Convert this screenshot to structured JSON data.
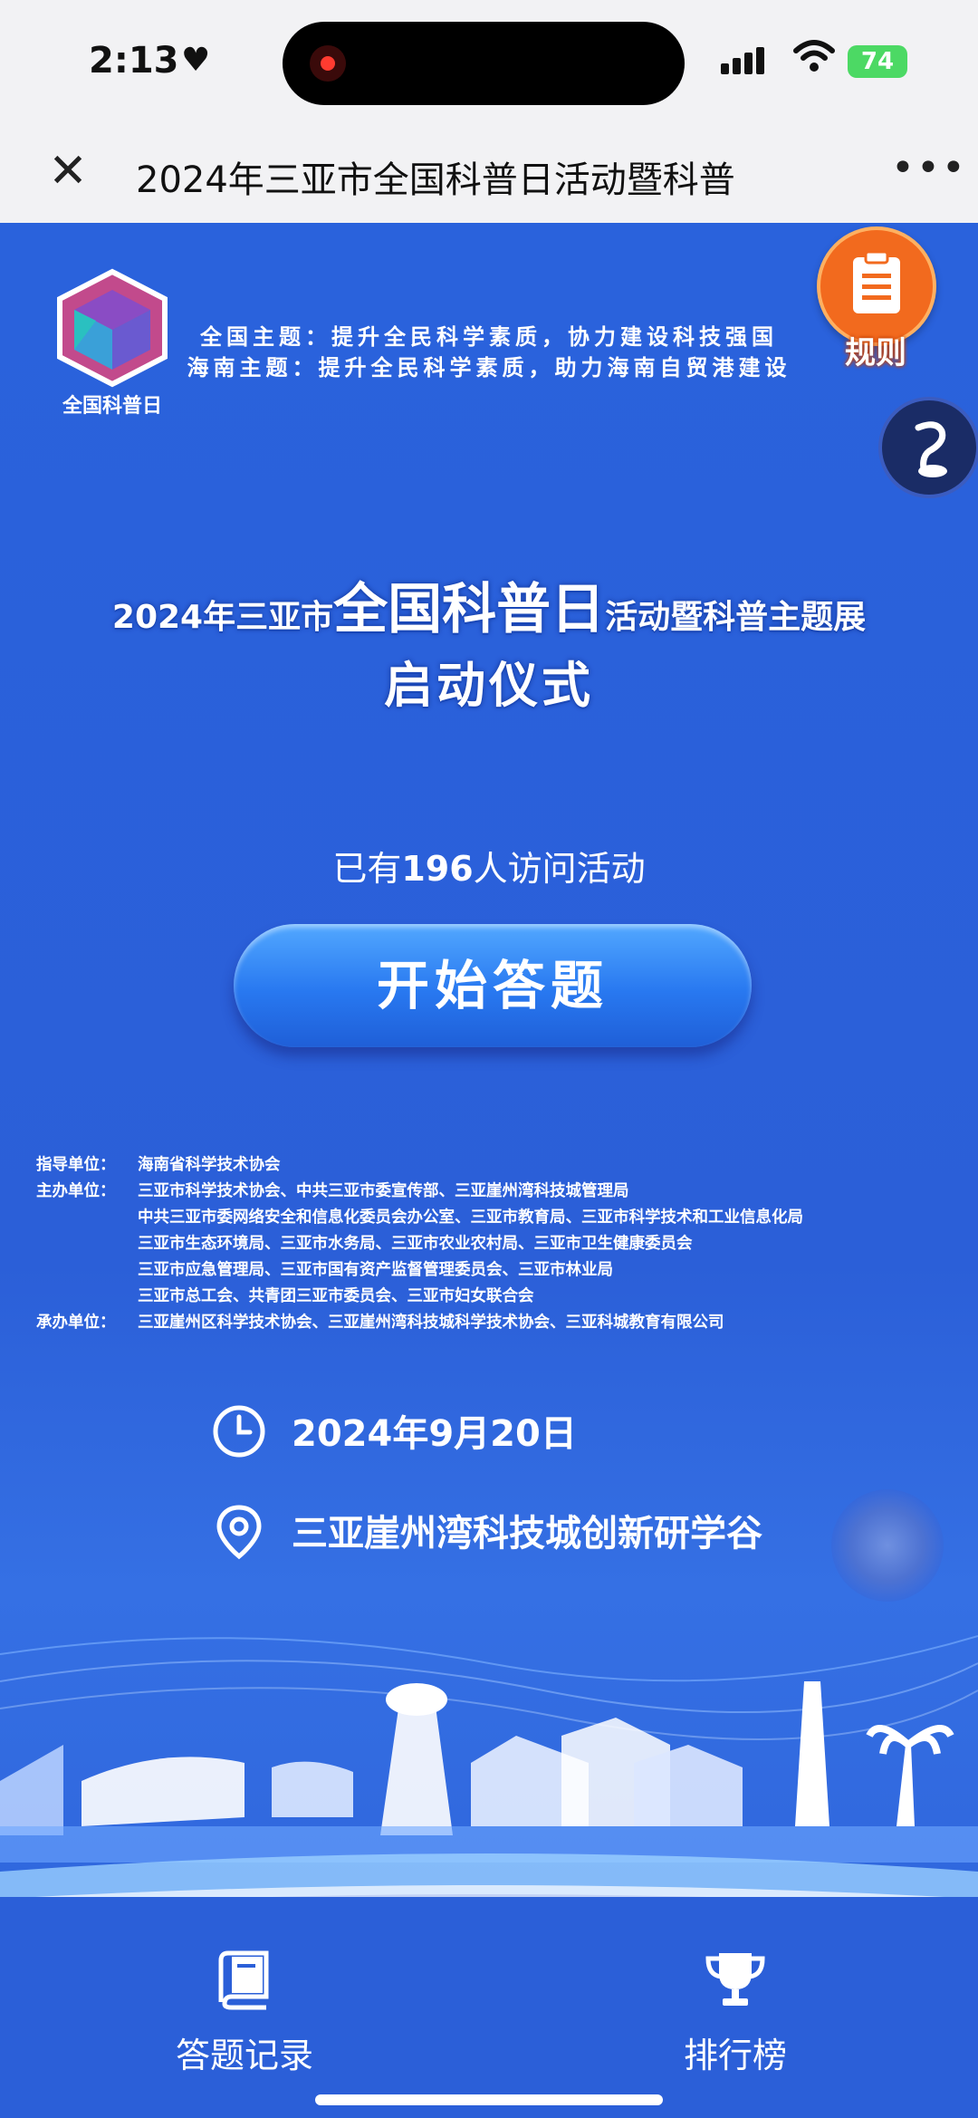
{
  "status_bar": {
    "time": "2:13",
    "battery": "74"
  },
  "nav": {
    "title": "2024年三亚市全国科普日活动暨科普"
  },
  "logo": {
    "text": "全国科普日"
  },
  "rules_button": {
    "label": "规则"
  },
  "themes": {
    "national": "全国主题：提升全民科学素质，协力建设科技强国",
    "hainan": "海南主题：提升全民科学素质，助力海南自贸港建设"
  },
  "headline": {
    "prefix": "2024年三亚市",
    "main": "全国科普日",
    "suffix": "活动暨科普主题展",
    "second_line": "启动仪式"
  },
  "visitors": {
    "before": "已有",
    "count": "196",
    "after": "人访问活动"
  },
  "start_button": {
    "label": "开始答题"
  },
  "organizers": [
    {
      "label": "指导单位：",
      "lines": [
        "海南省科学技术协会"
      ]
    },
    {
      "label": "主办单位：",
      "lines": [
        "三亚市科学技术协会、中共三亚市委宣传部、三亚崖州湾科技城管理局",
        "中共三亚市委网络安全和信息化委员会办公室、三亚市教育局、三亚市科学技术和工业信息化局",
        "三亚市生态环境局、三亚市水务局、三亚市农业农村局、三亚市卫生健康委员会",
        "三亚市应急管理局、三亚市国有资产监督管理委员会、三亚市林业局",
        "三亚市总工会、共青团三亚市委员会、三亚市妇女联合会"
      ]
    },
    {
      "label": "承办单位：",
      "lines": [
        "三亚崖州区科学技术协会、三亚崖州湾科技城科学技术协会、三亚科城教育有限公司"
      ]
    }
  ],
  "event": {
    "date": "2024年9月20日",
    "location": "三亚崖州湾科技城创新研学谷"
  },
  "tabs": {
    "records": "答题记录",
    "ranking": "排行榜"
  },
  "icons": {
    "clock": "clock-icon",
    "location": "location-pin-icon",
    "book": "book-icon",
    "trophy": "trophy-icon",
    "clipboard": "clipboard-icon",
    "music": "music-note-icon",
    "close": "close-icon",
    "more": "more-icon"
  },
  "colors": {
    "page_background": "#2a62dc",
    "rules_orange": "#f26a1e",
    "button_blue": "#2878f0",
    "status_bar": "#f2f2f4"
  }
}
